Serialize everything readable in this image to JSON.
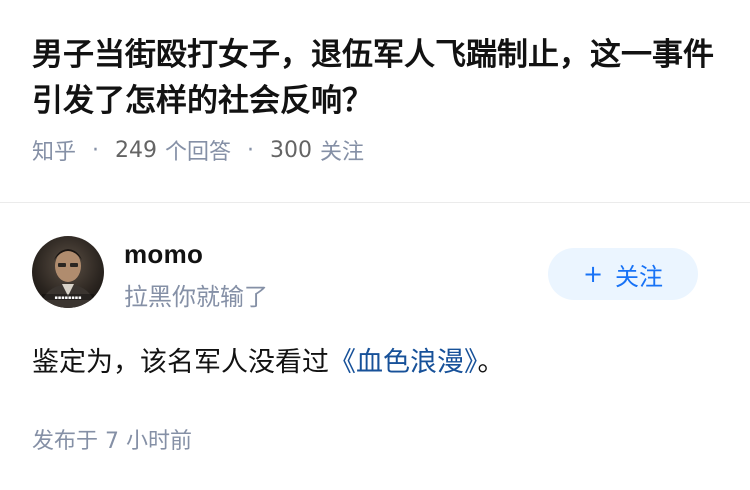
{
  "question": {
    "title": "男子当街殴打女子，退伍军人飞踹制止，这一事件引发了怎样的社会反响？",
    "source": "知乎",
    "answer_count": "249",
    "answer_label": "个回答",
    "follow_count": "300",
    "follow_label": "关注"
  },
  "answer": {
    "author_name": "momo",
    "author_bio": "拉黑你就输了",
    "follow_button": "关注",
    "follow_icon": "plus-icon",
    "content_prefix": "鉴定为，该名军人没看过",
    "content_link": "《血色浪漫》",
    "content_suffix": "。",
    "post_time": "发布于 7 小时前"
  },
  "colors": {
    "accent": "#1772f6",
    "link": "#175199",
    "meta": "#8590a6",
    "title": "#121212",
    "button_bg": "#ebf5ff"
  }
}
